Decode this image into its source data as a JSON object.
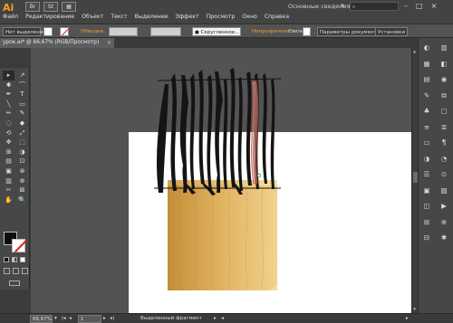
{
  "app": {
    "logo": "Ai",
    "workspace": "Основные сведения",
    "menu": [
      "Файл",
      "Редактирование",
      "Объект",
      "Текст",
      "Выделение",
      "Эффект",
      "Просмотр",
      "Окно",
      "Справка"
    ],
    "top_icons": [
      "Br",
      "St",
      "▦"
    ]
  },
  "control_bar": {
    "selection": "Нет выделения",
    "stroke_label": "Обводка:",
    "brush": "● Скругленное...",
    "opacity_label": "Непрозрачность",
    "styles_label": "Стили:",
    "doc_params_button": "Параметры документа",
    "prefs_button": "Установки"
  },
  "document": {
    "tab_title": "урок.ai* @ 66,67% (RGB/Просмотр)",
    "close": "×"
  },
  "toolbar": {
    "tools": [
      "▸",
      "↗",
      "✱",
      "⌒",
      "✒",
      "T",
      "╲",
      "▭",
      "✏",
      "✎",
      "◌",
      "◆",
      "⟲",
      "⤢",
      "✥",
      "⬚",
      "⊞",
      "◑",
      "▤",
      "⊡",
      "▣",
      "⊗",
      "▥",
      "⊕",
      "✂",
      "⊠",
      "✋",
      "🔍"
    ]
  },
  "statusbar": {
    "zoom": "66,67%",
    "page": "1",
    "status_text": "Выделенный фрагмент"
  },
  "colors": {
    "fill": "#0e0e0e",
    "stroke": "#ffffff",
    "accent": "#f7a21b",
    "wood_light": "#f1d28c",
    "wood_dark": "#c48d37"
  }
}
